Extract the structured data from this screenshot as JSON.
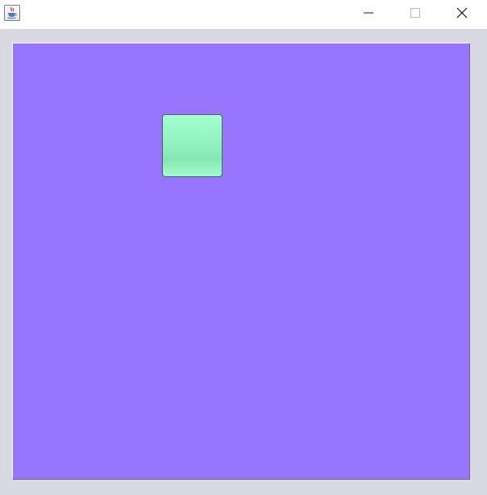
{
  "window": {
    "title": "",
    "icon": "java-cup-icon",
    "controls": {
      "minimize": "minimize-icon",
      "maximize": "maximize-icon",
      "close": "close-icon"
    }
  },
  "colors": {
    "canvas_background": "#9875ff",
    "square_fill": "#93f2c2",
    "frame_background": "#d9d9e3"
  }
}
